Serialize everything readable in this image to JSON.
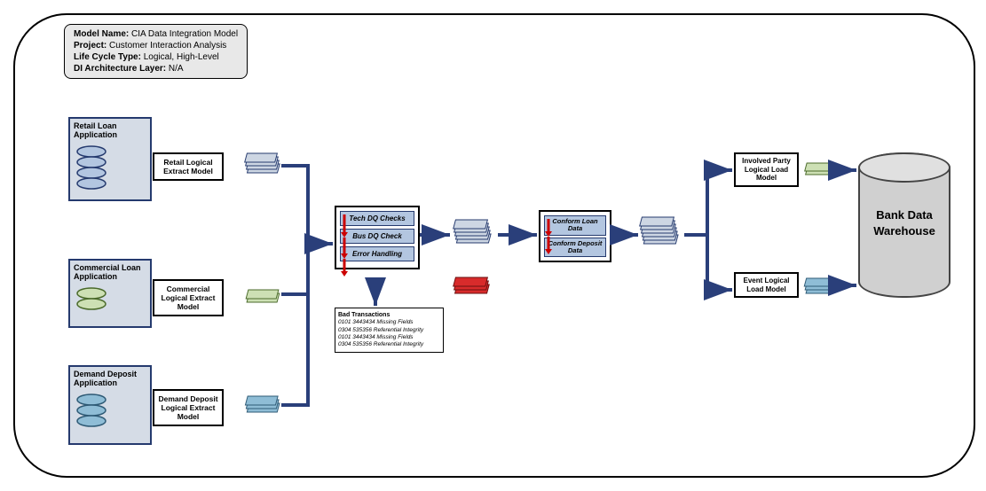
{
  "info": {
    "l1k": "Model Name:",
    "l1v": " CIA Data Integration Model",
    "l2k": "Project:",
    "l2v": " Customer Interaction Analysis",
    "l3k": "Life Cycle Type:",
    "l3v": " Logical, High-Level",
    "l4k": "DI Architecture Layer:",
    "l4v": " N/A"
  },
  "sources": {
    "retail": "Retail Loan Application",
    "commercial": "Commercial Loan Application",
    "demand": "Demand Deposit Application"
  },
  "extracts": {
    "retail": "Retail Logical Extract Model",
    "commercial": "Commercial Logical Extract Model",
    "demand": "Demand Deposit Logical Extract Model"
  },
  "dq": {
    "tech": "Tech DQ Checks",
    "bus": "Bus DQ Check",
    "err": "Error Handling"
  },
  "conform": {
    "loan": "Conform Loan Data",
    "deposit": "Conform Deposit Data"
  },
  "loads": {
    "involved": "Involved Party Logical Load Model",
    "event": "Event Logical Load Model"
  },
  "warehouse": "Bank Data Warehouse",
  "report": {
    "title": "Bad Transactions",
    "l1": "0101 3443434 Missing Fields",
    "l2": "0304 535356 Referential Integrity",
    "l3": "0101 3443434 Missing Fields",
    "l4": "0304 535356 Referential Integrity"
  }
}
